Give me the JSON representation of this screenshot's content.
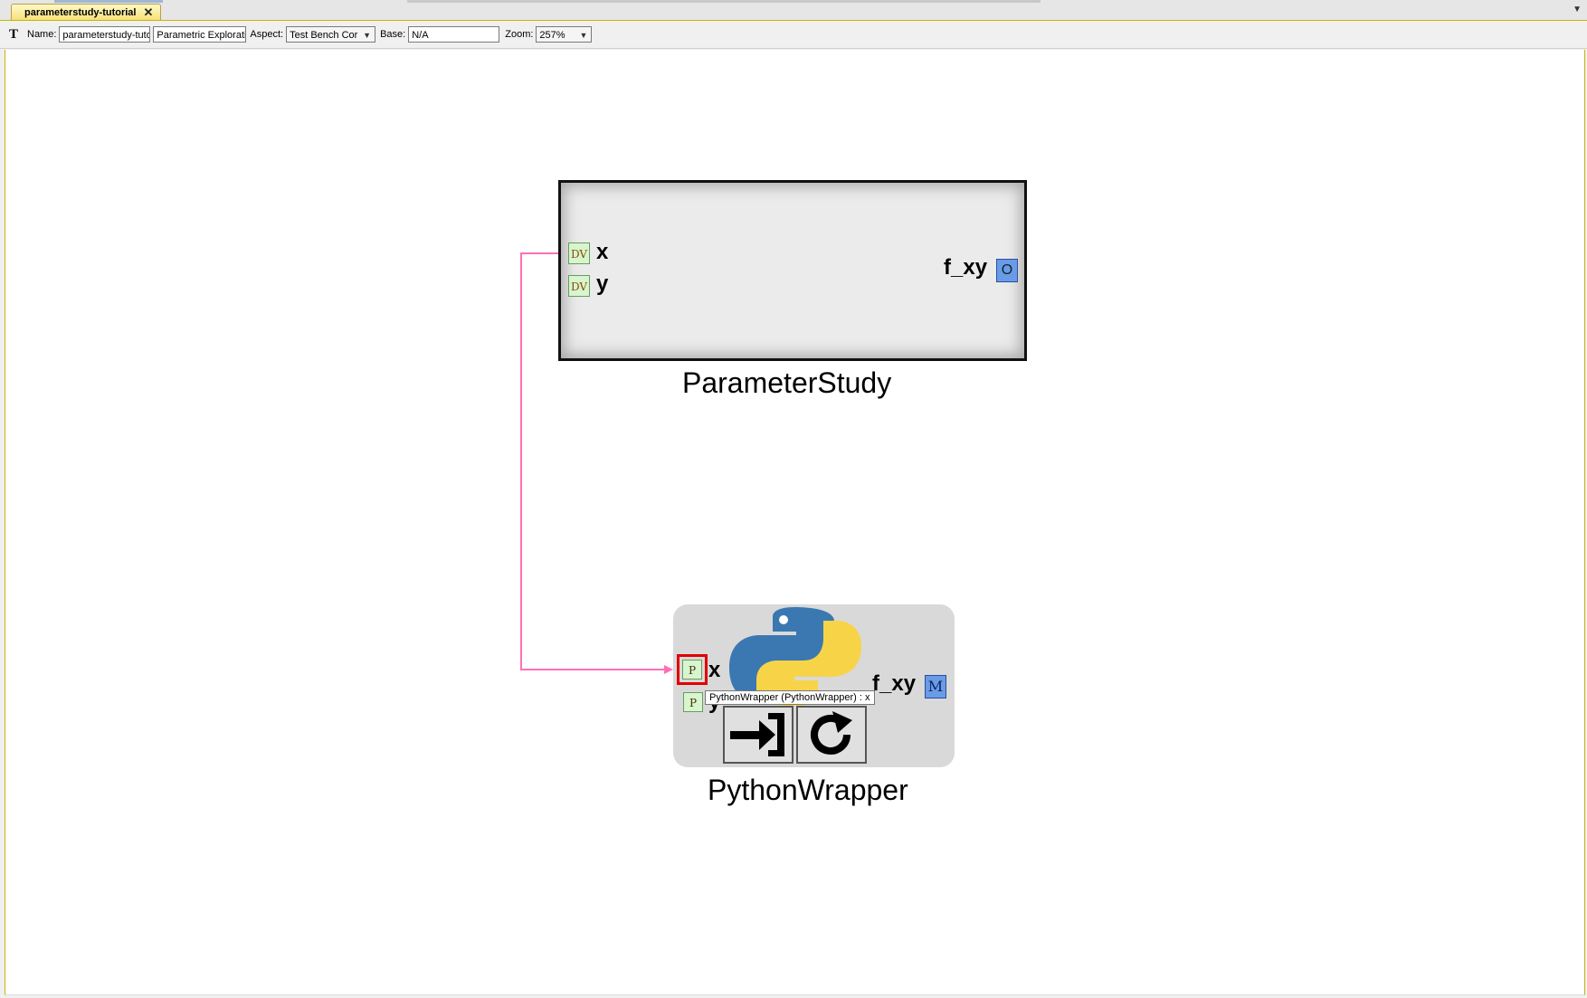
{
  "tab": {
    "title": "parameterstudy-tutorial",
    "close_glyph": "✕"
  },
  "menu": {
    "icon": "chevron-down-icon"
  },
  "toolbar": {
    "title_icon": "T",
    "name_label": "Name:",
    "name_value": "parameterstudy-tutor",
    "kind_value": "Parametric Exploratic",
    "aspect_label": "Aspect:",
    "aspect_value": "Test Bench Cor",
    "base_label": "Base:",
    "base_value": "N/A",
    "zoom_label": "Zoom:",
    "zoom_value": "257%"
  },
  "parameter_study": {
    "name": "ParameterStudy",
    "inputs": [
      {
        "badge": "DV",
        "label": "x"
      },
      {
        "badge": "DV",
        "label": "y"
      }
    ],
    "output": {
      "badge": "O",
      "label": "f_xy"
    }
  },
  "python_wrapper": {
    "name": "PythonWrapper",
    "inputs": [
      {
        "badge": "P",
        "label": "x"
      },
      {
        "badge": "P",
        "label": "y"
      }
    ],
    "output": {
      "badge": "M",
      "label": "f_xy"
    },
    "logo": "python-logo-icon",
    "buttons": [
      "open-arrow-icon",
      "refresh-icon"
    ]
  },
  "tooltip": {
    "text": "PythonWrapper (PythonWrapper) : x"
  },
  "colors": {
    "wire": "#ff6fb5",
    "selection": "#e00000",
    "tab_accent": "#f7e27a"
  }
}
